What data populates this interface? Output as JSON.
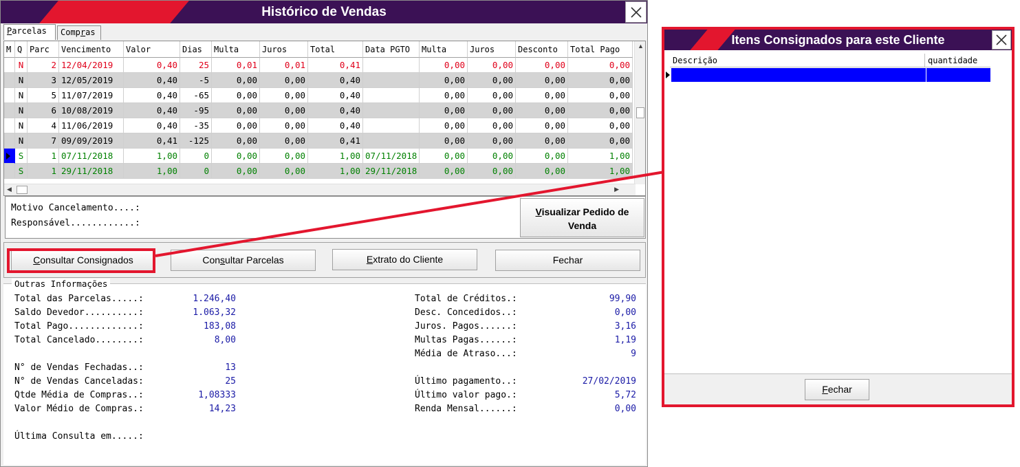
{
  "main_window": {
    "title": "Histórico de Vendas",
    "tabs": [
      {
        "label_u": "P",
        "label_rest": "arcelas"
      },
      {
        "label_pre": "Comp",
        "label_u": "r",
        "label_post": "as"
      }
    ],
    "grid": {
      "columns": [
        "M",
        "Q",
        "Parc",
        "Vencimento",
        "Valor",
        "Dias",
        "Multa",
        "Juros",
        "Total",
        "Data PGTO",
        "Multa",
        "Juros",
        "Desconto",
        "Total Pago"
      ],
      "rows": [
        {
          "m": "",
          "q": "N",
          "parc": "2",
          "venc": "12/04/2019",
          "valor": "0,40",
          "dias": "25",
          "multa": "0,01",
          "juros": "0,01",
          "total": "0,41",
          "data_pgto": "",
          "multa2": "0,00",
          "juros2": "0,00",
          "desconto": "0,00",
          "total_pago": "0,00"
        },
        {
          "m": "",
          "q": "N",
          "parc": "3",
          "venc": "12/05/2019",
          "valor": "0,40",
          "dias": "-5",
          "multa": "0,00",
          "juros": "0,00",
          "total": "0,40",
          "data_pgto": "",
          "multa2": "0,00",
          "juros2": "0,00",
          "desconto": "0,00",
          "total_pago": "0,00"
        },
        {
          "m": "",
          "q": "N",
          "parc": "5",
          "venc": "11/07/2019",
          "valor": "0,40",
          "dias": "-65",
          "multa": "0,00",
          "juros": "0,00",
          "total": "0,40",
          "data_pgto": "",
          "multa2": "0,00",
          "juros2": "0,00",
          "desconto": "0,00",
          "total_pago": "0,00"
        },
        {
          "m": "",
          "q": "N",
          "parc": "6",
          "venc": "10/08/2019",
          "valor": "0,40",
          "dias": "-95",
          "multa": "0,00",
          "juros": "0,00",
          "total": "0,40",
          "data_pgto": "",
          "multa2": "0,00",
          "juros2": "0,00",
          "desconto": "0,00",
          "total_pago": "0,00"
        },
        {
          "m": "",
          "q": "N",
          "parc": "4",
          "venc": "11/06/2019",
          "valor": "0,40",
          "dias": "-35",
          "multa": "0,00",
          "juros": "0,00",
          "total": "0,40",
          "data_pgto": "",
          "multa2": "0,00",
          "juros2": "0,00",
          "desconto": "0,00",
          "total_pago": "0,00"
        },
        {
          "m": "",
          "q": "N",
          "parc": "7",
          "venc": "09/09/2019",
          "valor": "0,41",
          "dias": "-125",
          "multa": "0,00",
          "juros": "0,00",
          "total": "0,41",
          "data_pgto": "",
          "multa2": "0,00",
          "juros2": "0,00",
          "desconto": "0,00",
          "total_pago": "0,00"
        },
        {
          "m": "",
          "q": "S",
          "parc": "1",
          "venc": "07/11/2018",
          "valor": "1,00",
          "dias": "0",
          "multa": "0,00",
          "juros": "0,00",
          "total": "1,00",
          "data_pgto": "07/11/2018",
          "multa2": "0,00",
          "juros2": "0,00",
          "desconto": "0,00",
          "total_pago": "1,00"
        },
        {
          "m": "",
          "q": "S",
          "parc": "1",
          "venc": "29/11/2018",
          "valor": "1,00",
          "dias": "0",
          "multa": "0,00",
          "juros": "0,00",
          "total": "1,00",
          "data_pgto": "29/11/2018",
          "multa2": "0,00",
          "juros2": "0,00",
          "desconto": "0,00",
          "total_pago": "1,00"
        }
      ],
      "row_colors": [
        "red",
        "blk",
        "blk",
        "blk",
        "blk",
        "blk",
        "green",
        "green"
      ]
    },
    "cancel_panel": {
      "motivo": "Motivo Cancelamento....:",
      "responsavel": "Responsável............:",
      "view_order_button_u": "V",
      "view_order_button_line1_rest": "isualizar Pedido de",
      "view_order_button_line2": "Venda"
    },
    "buttons": {
      "consignados_u": "C",
      "consignados_rest": "onsultar Consignados",
      "parcelas_pre": "Con",
      "parcelas_u": "s",
      "parcelas_post": "ultar Parcelas",
      "extrato_u": "E",
      "extrato_rest": "xtrato do Cliente",
      "fechar": "Fechar"
    },
    "other_info": {
      "legend": "Outras Informações",
      "left": [
        {
          "label": "Total das Parcelas.....:",
          "value": "1.246,40"
        },
        {
          "label": "Saldo Devedor..........:",
          "value": "1.063,32"
        },
        {
          "label": "Total Pago.............:",
          "value": "183,08"
        },
        {
          "label": "Total Cancelado........:",
          "value": "8,00"
        },
        {
          "label": "N° de Vendas Fechadas..:",
          "value": "13"
        },
        {
          "label": "N° de Vendas Canceladas:",
          "value": "25"
        },
        {
          "label": "Qtde Média de Compras..:",
          "value": "1,08333"
        },
        {
          "label": "Valor Médio de Compras.:",
          "value": "14,23"
        },
        {
          "label": "Última Consulta em.....:",
          "value": ""
        }
      ],
      "right": [
        {
          "label": "Total de Créditos.:",
          "value": "99,90"
        },
        {
          "label": "Desc. Concedidos..:",
          "value": "0,00"
        },
        {
          "label": "Juros. Pagos......:",
          "value": "3,16"
        },
        {
          "label": "Multas Pagas......:",
          "value": "1,19"
        },
        {
          "label": "Média de Atraso...:",
          "value": "9"
        },
        {
          "label": "Último pagamento..:",
          "value": "27/02/2019"
        },
        {
          "label": "Último valor pago.:",
          "value": "5,72"
        },
        {
          "label": "Renda Mensal......:",
          "value": "0,00"
        }
      ]
    }
  },
  "consignados_window": {
    "title": "Itens Consignados para este Cliente",
    "columns": [
      "Descrição",
      "quantidade"
    ],
    "close_button_u": "F",
    "close_button_rest": "echar"
  },
  "colors": {
    "title_bg": "#3b1155",
    "accent_red": "#e3162e",
    "value_blue": "#1a1aa6",
    "selection_blue": "#0000ff"
  }
}
